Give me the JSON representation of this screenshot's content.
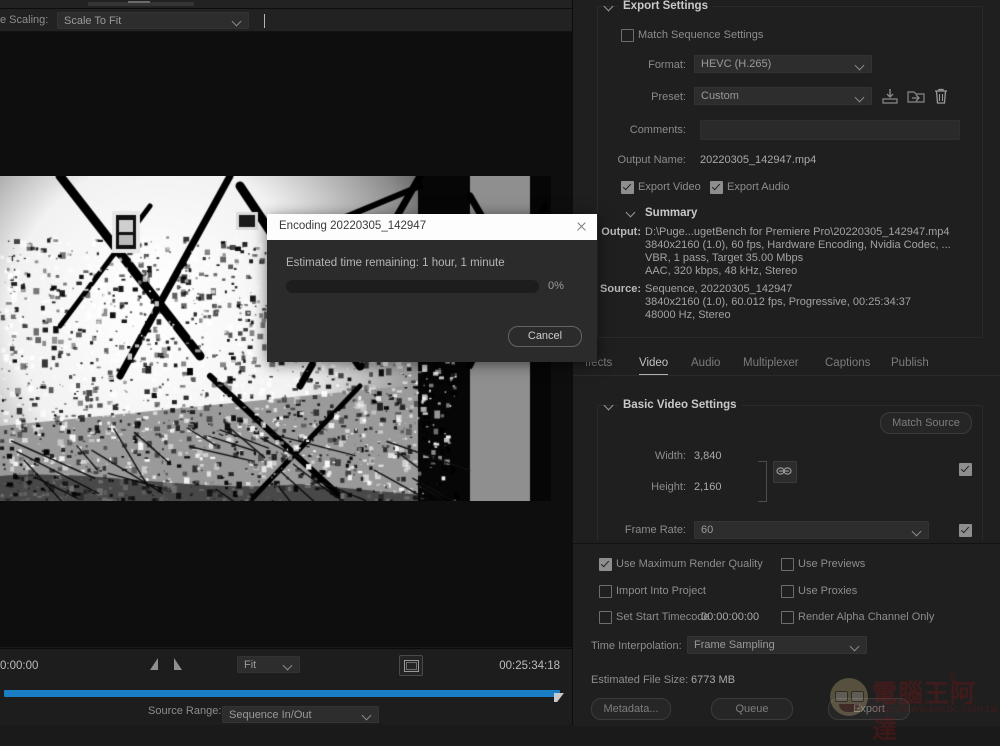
{
  "source_panel": {
    "scaling_label": "e Scaling:",
    "scaling_value": "Scale To Fit",
    "start_timecode": "0:00:00",
    "end_timecode": "00:25:34:18",
    "zoom_value": "Fit",
    "source_range_label": "Source Range:",
    "source_range_value": "Sequence In/Out"
  },
  "export_settings": {
    "section_title": "Export Settings",
    "match_sequence_label": "Match Sequence Settings",
    "format_label": "Format:",
    "format_value": "HEVC (H.265)",
    "preset_label": "Preset:",
    "preset_value": "Custom",
    "comments_label": "Comments:",
    "comments_value": "",
    "output_name_label": "Output Name:",
    "output_name_value": "20220305_142947.mp4",
    "export_video_label": "Export Video",
    "export_audio_label": "Export Audio",
    "preset_icons": [
      "save-preset-icon",
      "import-preset-icon",
      "delete-preset-icon"
    ]
  },
  "summary": {
    "title": "Summary",
    "output_key": "Output:",
    "output_lines": [
      "D:\\Puge...ugetBench for Premiere Pro\\20220305_142947.mp4",
      "3840x2160 (1.0), 60 fps, Hardware Encoding, Nvidia Codec, ...",
      "VBR, 1 pass, Target 35.00 Mbps",
      "AAC, 320 kbps, 48 kHz, Stereo"
    ],
    "source_key": "Source:",
    "source_lines": [
      "Sequence, 20220305_142947",
      "3840x2160 (1.0), 60.012 fps, Progressive, 00:25:34:37",
      "48000 Hz, Stereo"
    ]
  },
  "tabs": [
    {
      "label": "ffects",
      "active": false
    },
    {
      "label": "Video",
      "active": true
    },
    {
      "label": "Audio",
      "active": false
    },
    {
      "label": "Multiplexer",
      "active": false
    },
    {
      "label": "Captions",
      "active": false
    },
    {
      "label": "Publish",
      "active": false
    }
  ],
  "basic_video": {
    "section_title": "Basic Video Settings",
    "match_source_label": "Match Source",
    "width_label": "Width:",
    "width_value": "3,840",
    "height_label": "Height:",
    "height_value": "2,160",
    "frame_rate_label": "Frame Rate:",
    "frame_rate_value": "60"
  },
  "bottom_options": {
    "checkboxes": [
      {
        "label": "Use Maximum Render Quality",
        "checked": true
      },
      {
        "label": "Use Previews",
        "checked": false
      },
      {
        "label": "Import Into Project",
        "checked": false
      },
      {
        "label": "Use Proxies",
        "checked": false
      },
      {
        "label": "Set Start Timecode",
        "checked": false
      },
      {
        "label": "Render Alpha Channel Only",
        "checked": false
      }
    ],
    "start_timecode_value": "00:00:00:00",
    "time_interpolation_label": "Time Interpolation:",
    "time_interpolation_value": "Frame Sampling",
    "file_size_label": "Estimated File Size:",
    "file_size_value": "6773 MB",
    "buttons": [
      "Metadata...",
      "Queue",
      "Export"
    ]
  },
  "dialog": {
    "title": "Encoding 20220305_142947",
    "message": "Estimated time remaining: 1 hour, 1 minute",
    "progress_percent": "0%",
    "progress_value": 0,
    "cancel_label": "Cancel",
    "close_icon": "close-icon"
  },
  "watermark": {
    "text": "電腦王阿達",
    "url": "http://www.kocpc.com.tw"
  },
  "colors": {
    "accent_blue": "#1a7ec4",
    "panel_bg": "#1f1f1f",
    "dialog_bg": "#2b2b2b"
  }
}
